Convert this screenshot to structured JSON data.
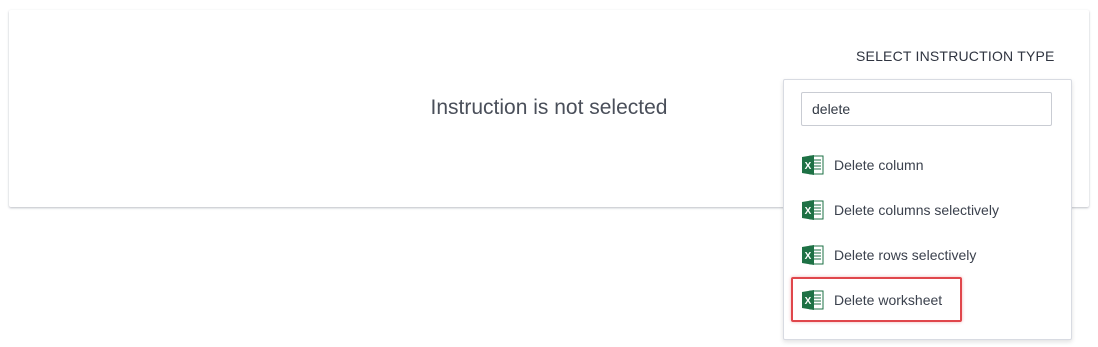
{
  "main": {
    "empty_message": "Instruction is not selected"
  },
  "instruction_type": {
    "heading": "SELECT INSTRUCTION TYPE",
    "search": {
      "value": "delete",
      "placeholder": ""
    },
    "options": [
      {
        "label": "Delete column",
        "icon": "excel-icon"
      },
      {
        "label": "Delete columns selectively",
        "icon": "excel-icon"
      },
      {
        "label": "Delete rows selectively",
        "icon": "excel-icon"
      },
      {
        "label": "Delete worksheet",
        "icon": "excel-icon",
        "highlighted": true
      }
    ]
  },
  "colors": {
    "excel_green": "#1e7145",
    "highlight_border": "#e0474c"
  }
}
